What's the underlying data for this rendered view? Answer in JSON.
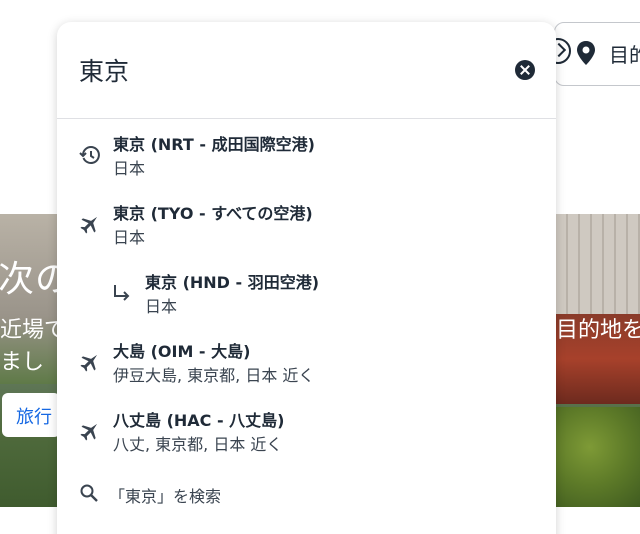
{
  "background": {
    "hero_title": "次の",
    "hero_sub_line1": "近場で",
    "hero_sub_line2": "まし",
    "hero_sub_right": "目的地を",
    "hero_button": "旅行",
    "destination_field_text": "目的"
  },
  "search": {
    "value": "東京",
    "clear_icon": "clear-icon"
  },
  "suggestions": [
    {
      "icon": "history-icon",
      "title": "東京 (NRT - 成田国際空港)",
      "subtitle": "日本"
    },
    {
      "icon": "plane-icon",
      "title": "東京 (TYO - すべての空港)",
      "subtitle": "日本"
    },
    {
      "icon": "sub-arrow-icon",
      "title": "東京 (HND - 羽田空港)",
      "subtitle": "日本"
    },
    {
      "icon": "plane-icon",
      "title": "大島 (OIM - 大島)",
      "subtitle": "伊豆大島, 東京都, 日本 近く"
    },
    {
      "icon": "plane-icon",
      "title": "八丈島 (HAC - 八丈島)",
      "subtitle": "八丈, 東京都, 日本 近く"
    }
  ],
  "search_all": {
    "icon": "search-icon",
    "label": "「東京」を検索"
  },
  "colors": {
    "text_primary": "#1f2a37",
    "accent": "#1668e3"
  }
}
